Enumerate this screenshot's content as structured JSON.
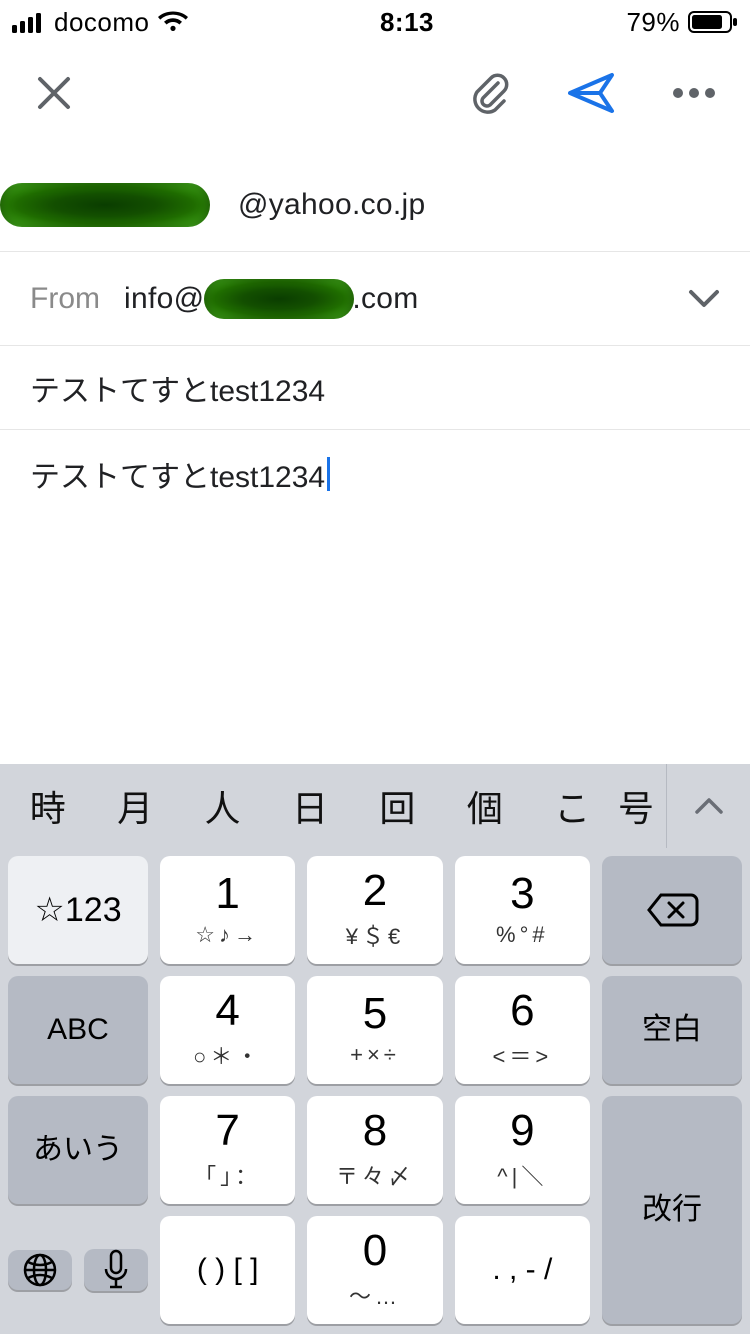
{
  "status": {
    "carrier": "docomo",
    "time": "8:13",
    "battery_pct": "79%"
  },
  "compose": {
    "to_suffix": "@yahoo.co.jp",
    "from_label": "From",
    "from_prefix": "info@",
    "from_suffix": ".com",
    "subject": "テストてすとtest1234",
    "body": "テストてすとtest1234"
  },
  "keyboard": {
    "candidates": [
      "時",
      "月",
      "人",
      "日",
      "回",
      "個",
      "こ",
      "号"
    ],
    "rows": [
      {
        "left": "☆123",
        "keys": [
          {
            "main": "1",
            "sub": "☆♪→"
          },
          {
            "main": "2",
            "sub": "¥＄€"
          },
          {
            "main": "3",
            "sub": "%°#"
          }
        ],
        "right_icon": "backspace"
      },
      {
        "left": "ABC",
        "keys": [
          {
            "main": "4",
            "sub": "○＊・"
          },
          {
            "main": "5",
            "sub": "+×÷"
          },
          {
            "main": "6",
            "sub": "<＝>"
          }
        ],
        "right": "空白"
      },
      {
        "left": "あいう",
        "keys": [
          {
            "main": "7",
            "sub": "「」："
          },
          {
            "main": "8",
            "sub": "〒々〆"
          },
          {
            "main": "9",
            "sub": "^|＼"
          }
        ],
        "right": "改行"
      },
      {
        "left_icons": [
          "globe",
          "mic"
        ],
        "keys": [
          {
            "main": "( ) [ ]",
            "sub": ""
          },
          {
            "main": "0",
            "sub": "〜…"
          },
          {
            "main": ". , - /",
            "sub": ""
          }
        ]
      }
    ]
  }
}
